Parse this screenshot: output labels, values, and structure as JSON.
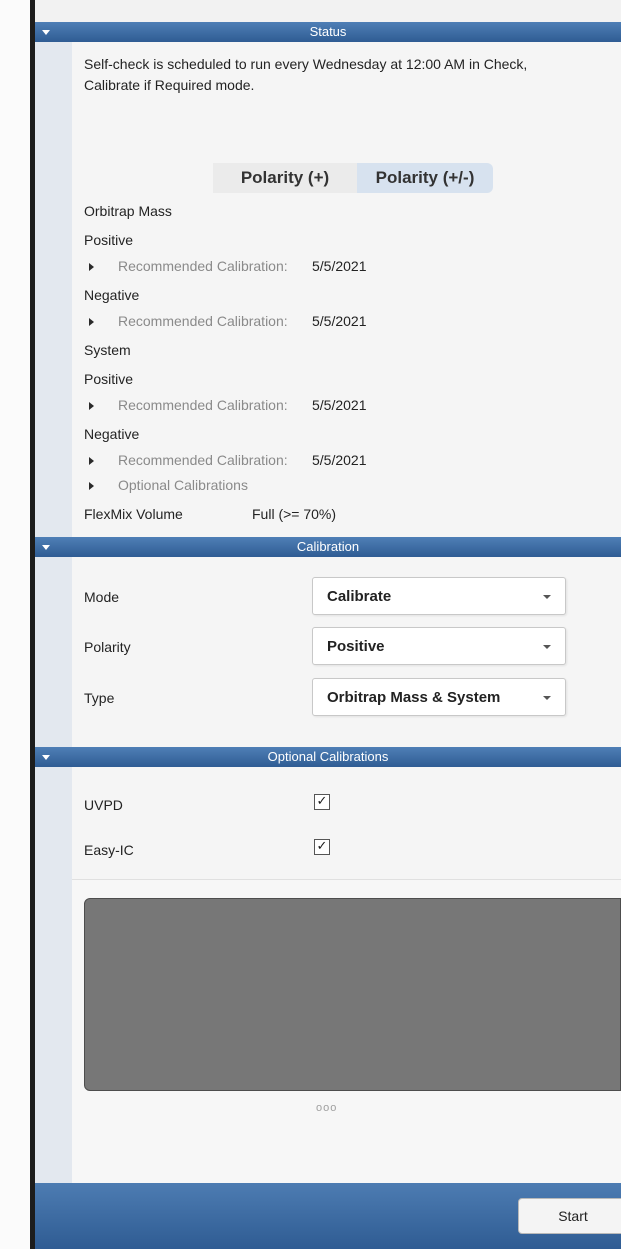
{
  "status": {
    "header": "Status",
    "message_line1": "Self-check is scheduled to run every Wednesday at 12:00 AM in Check,",
    "message_line2": "Calibrate if Required mode.",
    "polarity_tabs": [
      "Polarity (+)",
      "Polarity (+/-)"
    ],
    "selected_polarity_tab": "Polarity (+/-)",
    "orbitrap_mass": {
      "title": "Orbitrap Mass",
      "positive_label": "Positive",
      "positive_recommended_label": "Recommended Calibration:",
      "positive_recommended_date": "5/5/2021",
      "negative_label": "Negative",
      "negative_recommended_label": "Recommended Calibration:",
      "negative_recommended_date": "5/5/2021"
    },
    "system": {
      "title": "System",
      "positive_label": "Positive",
      "positive_recommended_label": "Recommended Calibration:",
      "positive_recommended_date": "5/5/2021",
      "negative_label": "Negative",
      "negative_recommended_label": "Recommended Calibration:",
      "negative_recommended_date": "5/5/2021"
    },
    "optional_calibrations_label": "Optional Calibrations",
    "flexmix": {
      "label": "FlexMix Volume",
      "value": "Full (>= 70%)"
    }
  },
  "calibration": {
    "header": "Calibration",
    "mode_label": "Mode",
    "mode_value": "Calibrate",
    "polarity_label": "Polarity",
    "polarity_value": "Positive",
    "type_label": "Type",
    "type_value": "Orbitrap Mass & System"
  },
  "optional_calibrations": {
    "header": "Optional Calibrations",
    "uvpd_label": "UVPD",
    "uvpd_checked": true,
    "easyic_label": "Easy-IC",
    "easyic_checked": true
  },
  "progress_dots": "ooo",
  "footer": {
    "start_label": "Start"
  },
  "colors": {
    "header_blue_top": "#4f7fb6",
    "header_blue_bottom": "#2f5c93",
    "gutter": "#e3e8ef",
    "toggle_selected": "#d7e2ef",
    "panel_gray": "#777777"
  },
  "icons": [
    "collapse-arrow-icon",
    "expand-triangle-icon",
    "dropdown-caret-icon",
    "checkmark-icon"
  ]
}
